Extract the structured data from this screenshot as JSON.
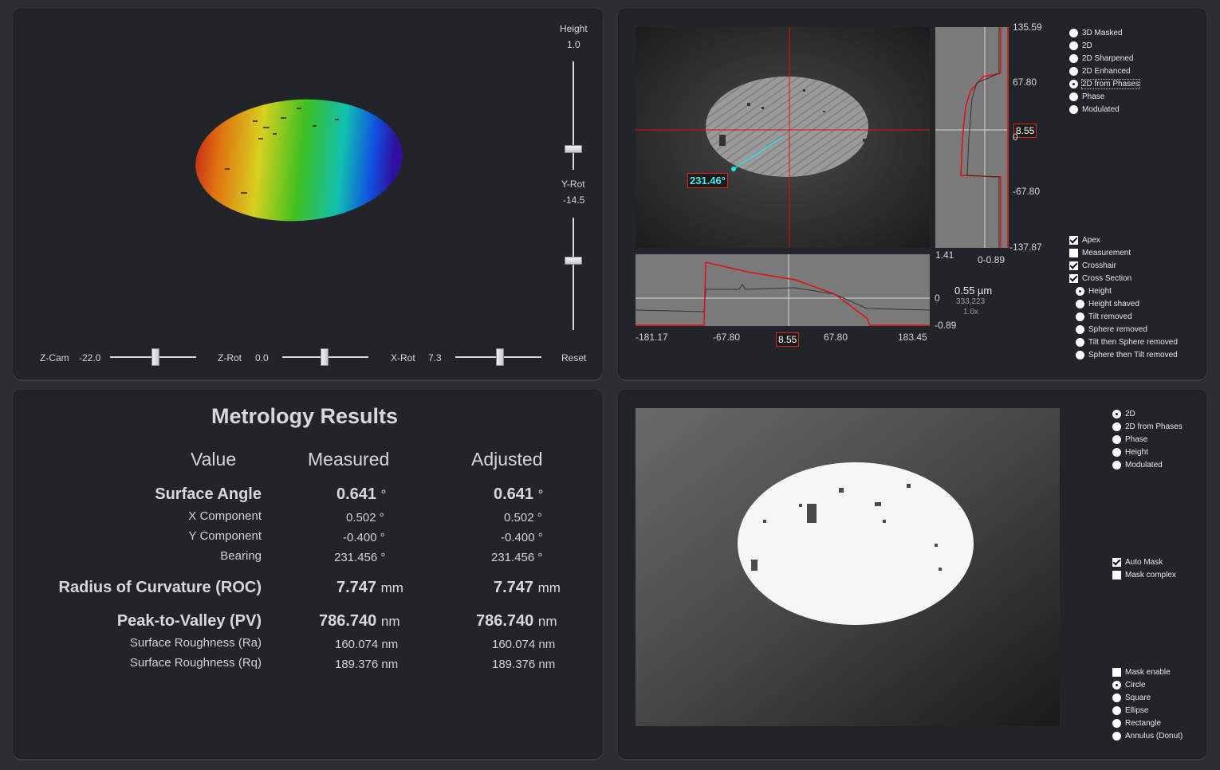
{
  "view3d": {
    "height_label": "Height",
    "height_value": "1.0",
    "yrot_label": "Y-Rot",
    "yrot_value": "-14.5",
    "zcam_label": "Z-Cam",
    "zcam_value": "-22.0",
    "zrot_label": "Z-Rot",
    "zrot_value": "0.0",
    "xrot_label": "X-Rot",
    "xrot_value": "7.3",
    "reset_label": "Reset"
  },
  "profile": {
    "angle_tag": "231.46°",
    "v_top": "135.59",
    "v_upper": "67.80",
    "v_cursor": "8.55",
    "v_zero": "0",
    "v_lower": "-67.80",
    "v_bottom": "-137.87",
    "v_left": "1.41",
    "v_range": "0-0.89",
    "h_left": "-181.17",
    "h_mid_left": "-67.80",
    "h_cursor": "8.55",
    "h_mid_right": "67.80",
    "h_right": "183.45",
    "h_zero": "0",
    "h_min": "-0.89",
    "readout_value": "0.55 µm",
    "readout_coords": "333,223",
    "readout_zoom": "1.0x"
  },
  "display_modes": [
    {
      "label": "3D Masked",
      "selected": false
    },
    {
      "label": "2D",
      "selected": false
    },
    {
      "label": "2D Sharpened",
      "selected": false
    },
    {
      "label": "2D Enhanced",
      "selected": false
    },
    {
      "label": "2D from Phases",
      "selected": true
    },
    {
      "label": "Phase",
      "selected": false
    },
    {
      "label": "Modulated",
      "selected": false
    }
  ],
  "overlay_options": [
    {
      "label": "Apex",
      "checked": true
    },
    {
      "label": "Measurement",
      "checked": false
    },
    {
      "label": "Crosshair",
      "checked": true
    },
    {
      "label": "Cross Section",
      "checked": true
    }
  ],
  "section_modes": [
    {
      "label": "Height",
      "selected": true
    },
    {
      "label": "Height shaved",
      "selected": false
    },
    {
      "label": "Tilt removed",
      "selected": false
    },
    {
      "label": "Sphere removed",
      "selected": false
    },
    {
      "label": "Tilt then Sphere removed",
      "selected": false
    },
    {
      "label": "Sphere then Tilt removed",
      "selected": false
    }
  ],
  "results": {
    "title": "Metrology Results",
    "col_value": "Value",
    "col_measured": "Measured",
    "col_adjusted": "Adjusted",
    "rows": [
      {
        "label": "Surface Angle",
        "measured": "0.641",
        "adjusted": "0.641",
        "unit": "°"
      },
      {
        "label": "X Component",
        "measured": "0.502 °",
        "adjusted": "0.502 °"
      },
      {
        "label": "Y Component",
        "measured": "-0.400 °",
        "adjusted": "-0.400 °"
      },
      {
        "label": "Bearing",
        "measured": "231.456 °",
        "adjusted": "231.456 °"
      },
      {
        "label": "Radius of Curvature (ROC)",
        "measured": "7.747",
        "adjusted": "7.747",
        "unit": "mm"
      },
      {
        "label": "Peak-to-Valley (PV)",
        "measured": "786.740",
        "adjusted": "786.740",
        "unit": "nm"
      },
      {
        "label": "Surface Roughness (Ra)",
        "measured": "160.074 nm",
        "adjusted": "160.074 nm"
      },
      {
        "label": "Surface Roughness (Rq)",
        "measured": "189.376 nm",
        "adjusted": "189.376 nm"
      }
    ]
  },
  "camera_modes": [
    {
      "label": "2D",
      "selected": true
    },
    {
      "label": "2D from Phases",
      "selected": false
    },
    {
      "label": "Phase",
      "selected": false
    },
    {
      "label": "Height",
      "selected": false
    },
    {
      "label": "Modulated",
      "selected": false
    }
  ],
  "mask_options": [
    {
      "label": "Auto Mask",
      "checked": true
    },
    {
      "label": "Mask complex",
      "checked": false
    }
  ],
  "mask_enable": {
    "label": "Mask enable",
    "checked": false
  },
  "mask_shapes": [
    {
      "label": "Circle",
      "selected": true
    },
    {
      "label": "Square",
      "selected": false
    },
    {
      "label": "Ellipse",
      "selected": false
    },
    {
      "label": "Rectangle",
      "selected": false
    },
    {
      "label": "Annulus (Donut)",
      "selected": false
    }
  ]
}
